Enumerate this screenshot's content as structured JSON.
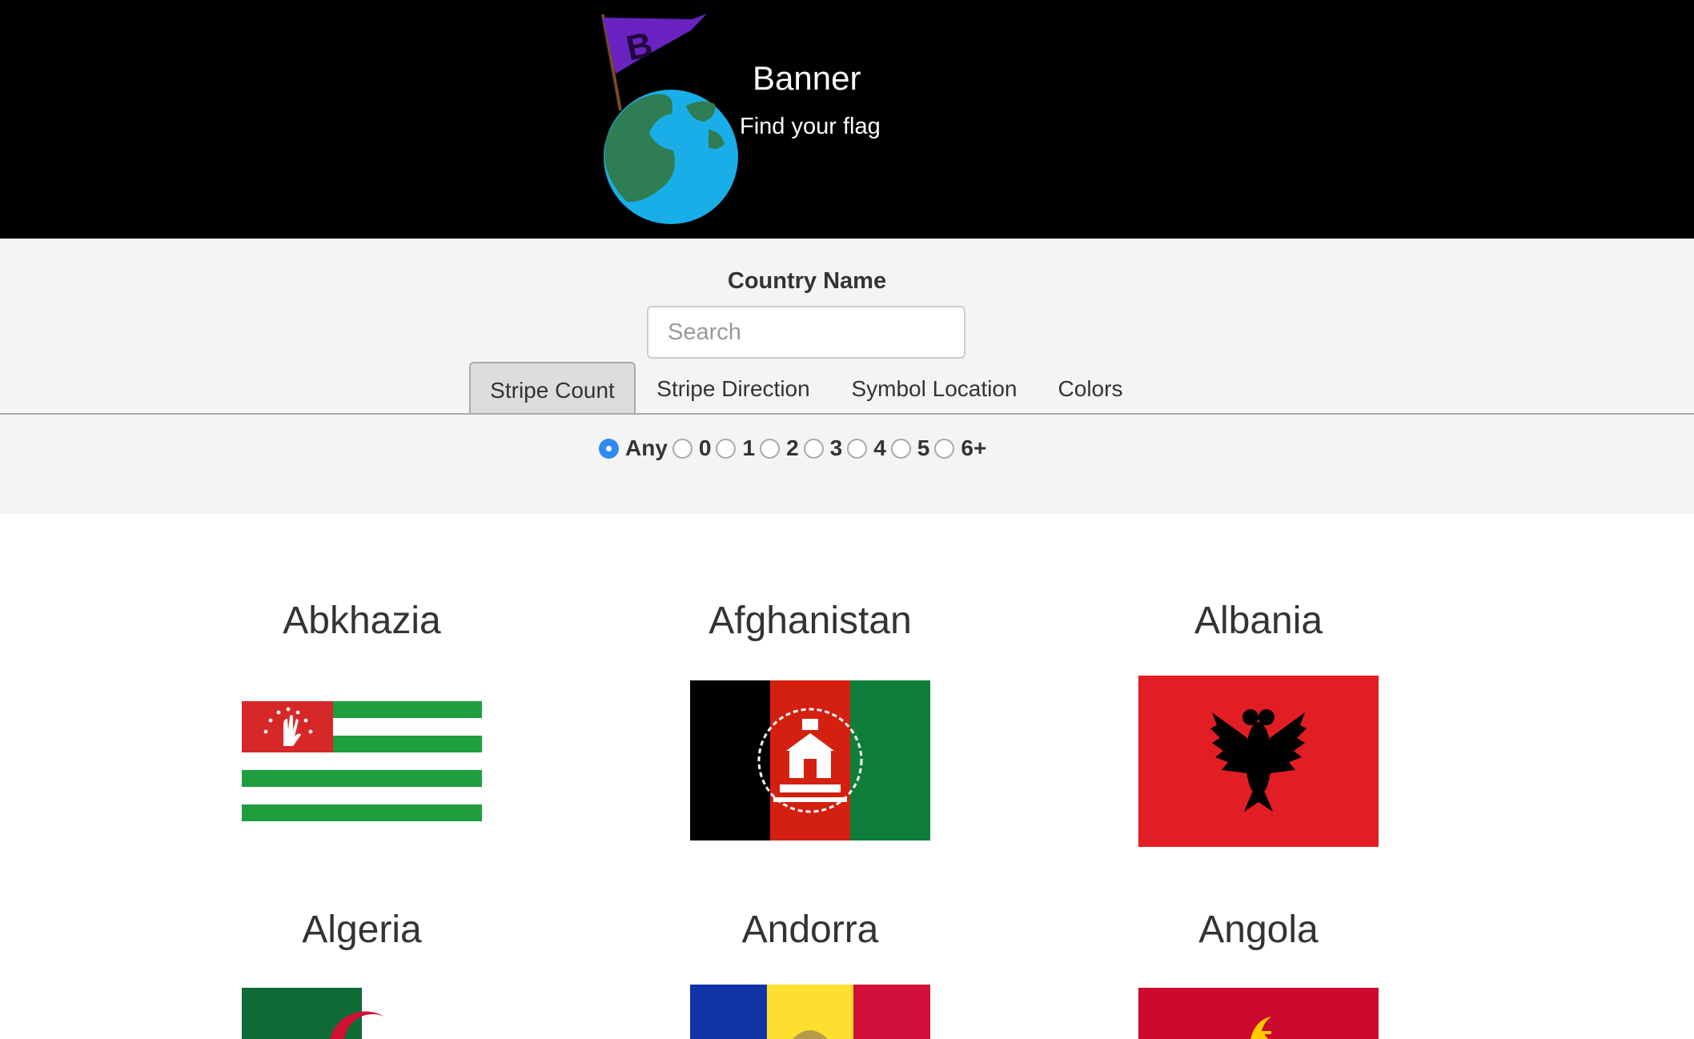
{
  "header": {
    "title": "Banner",
    "tagline": "Find your flag",
    "logo_letter": "B"
  },
  "search": {
    "label": "Country Name",
    "placeholder": "Search",
    "value": ""
  },
  "tabs": [
    {
      "label": "Stripe Count",
      "active": true
    },
    {
      "label": "Stripe Direction",
      "active": false
    },
    {
      "label": "Symbol Location",
      "active": false
    },
    {
      "label": "Colors",
      "active": false
    }
  ],
  "stripe_count": {
    "selected": "Any",
    "options": [
      "Any",
      "0",
      "1",
      "2",
      "3",
      "4",
      "5",
      "6+"
    ]
  },
  "countries": [
    {
      "name": "Abkhazia"
    },
    {
      "name": "Afghanistan"
    },
    {
      "name": "Albania"
    },
    {
      "name": "Algeria"
    },
    {
      "name": "Andorra"
    },
    {
      "name": "Angola"
    }
  ],
  "colors": {
    "accent": "#2e8af0",
    "header_bg": "#000000",
    "filter_bg": "#f4f4f4"
  }
}
